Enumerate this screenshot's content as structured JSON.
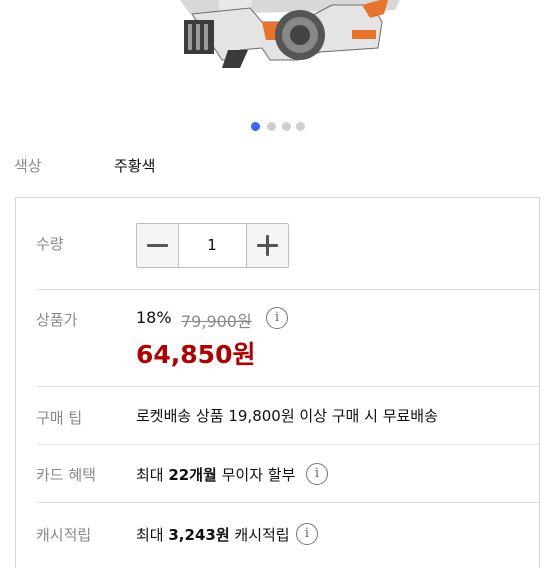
{
  "product": {
    "image_alt": "NERF 블래스터 제품 이미지",
    "carousel": {
      "count": 4,
      "active_index": 0
    }
  },
  "color_option": {
    "label": "색상",
    "value": "주황색"
  },
  "quantity": {
    "label": "수량",
    "value": "1",
    "minus_icon": "minus-icon",
    "plus_icon": "plus-icon"
  },
  "price": {
    "label": "상품가",
    "discount": "18%",
    "original": "79,900원",
    "sale": "64,850원",
    "info_icon": "i"
  },
  "purchase_tip": {
    "label": "구매 팁",
    "text": "로켓배송 상품 19,800원 이상 구매 시 무료배송"
  },
  "card_benefit": {
    "label": "카드 혜택",
    "prefix": "최대 ",
    "highlight": "22개월",
    "suffix": " 무이자 할부",
    "info_icon": "i"
  },
  "cash_reward": {
    "label": "캐시적립",
    "prefix": "최대 ",
    "highlight": "3,243원",
    "suffix": " 캐시적립",
    "info_icon": "i"
  },
  "colors": {
    "accent_blue": "#346aff",
    "sale_red": "#ae0000"
  }
}
